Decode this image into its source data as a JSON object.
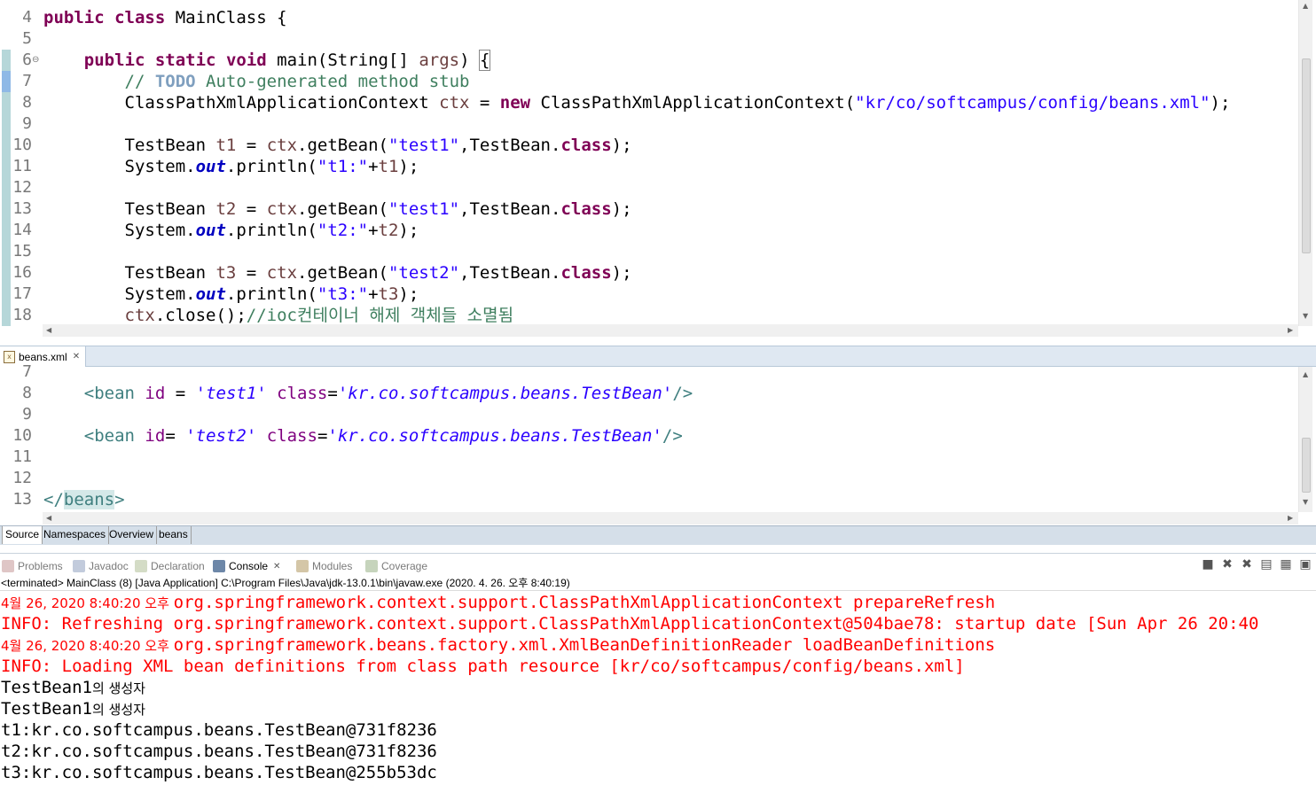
{
  "java_editor": {
    "lines": [
      {
        "num": "4",
        "tokens": [
          [
            "kw",
            "public"
          ],
          [
            "p",
            " "
          ],
          [
            "kw",
            "class"
          ],
          [
            "p",
            " MainClass {"
          ]
        ]
      },
      {
        "num": "5",
        "tokens": []
      },
      {
        "num": "6",
        "marker": "⊖",
        "tokens": [
          [
            "p",
            "    "
          ],
          [
            "kw",
            "public"
          ],
          [
            "p",
            " "
          ],
          [
            "kw",
            "static"
          ],
          [
            "p",
            " "
          ],
          [
            "kw",
            "void"
          ],
          [
            "p",
            " main(String[] "
          ],
          [
            "var",
            "args"
          ],
          [
            "p",
            ") {"
          ]
        ]
      },
      {
        "num": "7",
        "tokens": [
          [
            "p",
            "        "
          ],
          [
            "cmt",
            "// "
          ],
          [
            "todo",
            "TODO"
          ],
          [
            "cmt",
            " Auto-generated method stub"
          ]
        ]
      },
      {
        "num": "8",
        "tokens": [
          [
            "p",
            "        ClassPathXmlApplicationContext "
          ],
          [
            "var",
            "ctx"
          ],
          [
            "p",
            " = "
          ],
          [
            "kw",
            "new"
          ],
          [
            "p",
            " ClassPathXmlApplicationContext("
          ],
          [
            "str",
            "\"kr/co/softcampus/config/beans.xml\""
          ],
          [
            "p",
            ");"
          ]
        ]
      },
      {
        "num": "9",
        "tokens": []
      },
      {
        "num": "10",
        "tokens": [
          [
            "p",
            "        TestBean "
          ],
          [
            "var",
            "t1"
          ],
          [
            "p",
            " = "
          ],
          [
            "var",
            "ctx"
          ],
          [
            "p",
            ".getBean("
          ],
          [
            "str",
            "\"test1\""
          ],
          [
            "p",
            ",TestBean."
          ],
          [
            "kw",
            "class"
          ],
          [
            "p",
            ");"
          ]
        ]
      },
      {
        "num": "11",
        "tokens": [
          [
            "p",
            "        System."
          ],
          [
            "fld",
            "out"
          ],
          [
            "p",
            ".println("
          ],
          [
            "str",
            "\"t1:\""
          ],
          [
            "p",
            "+"
          ],
          [
            "var",
            "t1"
          ],
          [
            "p",
            ");"
          ]
        ]
      },
      {
        "num": "12",
        "tokens": []
      },
      {
        "num": "13",
        "tokens": [
          [
            "p",
            "        TestBean "
          ],
          [
            "var",
            "t2"
          ],
          [
            "p",
            " = "
          ],
          [
            "var",
            "ctx"
          ],
          [
            "p",
            ".getBean("
          ],
          [
            "str",
            "\"test1\""
          ],
          [
            "p",
            ",TestBean."
          ],
          [
            "kw",
            "class"
          ],
          [
            "p",
            ");"
          ]
        ]
      },
      {
        "num": "14",
        "tokens": [
          [
            "p",
            "        System."
          ],
          [
            "fld",
            "out"
          ],
          [
            "p",
            ".println("
          ],
          [
            "str",
            "\"t2:\""
          ],
          [
            "p",
            "+"
          ],
          [
            "var",
            "t2"
          ],
          [
            "p",
            ");"
          ]
        ]
      },
      {
        "num": "15",
        "tokens": []
      },
      {
        "num": "16",
        "tokens": [
          [
            "p",
            "        TestBean "
          ],
          [
            "var",
            "t3"
          ],
          [
            "p",
            " = "
          ],
          [
            "var",
            "ctx"
          ],
          [
            "p",
            ".getBean("
          ],
          [
            "str",
            "\"test2\""
          ],
          [
            "p",
            ",TestBean."
          ],
          [
            "kw",
            "class"
          ],
          [
            "p",
            ");"
          ]
        ]
      },
      {
        "num": "17",
        "tokens": [
          [
            "p",
            "        System."
          ],
          [
            "fld",
            "out"
          ],
          [
            "p",
            ".println("
          ],
          [
            "str",
            "\"t3:\""
          ],
          [
            "p",
            "+"
          ],
          [
            "var",
            "t3"
          ],
          [
            "p",
            ");"
          ]
        ]
      },
      {
        "num": "18",
        "tokens": [
          [
            "p",
            "        "
          ],
          [
            "var",
            "ctx"
          ],
          [
            "p",
            ".close();"
          ],
          [
            "cmt",
            "//ioc컨테이너 해제 객체들 소멸됨"
          ]
        ]
      }
    ]
  },
  "xml_editor": {
    "tab_label": "beans.xml",
    "tab_close": "✕",
    "lines": [
      {
        "num": "7",
        "tokens": []
      },
      {
        "num": "8",
        "tokens": [
          [
            "p",
            "    "
          ],
          [
            "xtag",
            "<bean"
          ],
          [
            "p",
            " "
          ],
          [
            "xattr",
            "id"
          ],
          [
            "p",
            " = "
          ],
          [
            "xval",
            "'test1'"
          ],
          [
            "p",
            " "
          ],
          [
            "xattr",
            "class"
          ],
          [
            "p",
            "="
          ],
          [
            "xval",
            "'kr.co.softcampus.beans.TestBean'"
          ],
          [
            "xtag",
            "/>"
          ]
        ]
      },
      {
        "num": "9",
        "tokens": []
      },
      {
        "num": "10",
        "tokens": [
          [
            "p",
            "    "
          ],
          [
            "xtag",
            "<bean"
          ],
          [
            "p",
            " "
          ],
          [
            "xattr",
            "id"
          ],
          [
            "p",
            "= "
          ],
          [
            "xval",
            "'test2'"
          ],
          [
            "p",
            " "
          ],
          [
            "xattr",
            "class"
          ],
          [
            "p",
            "="
          ],
          [
            "xval",
            "'kr.co.softcampus.beans.TestBean'"
          ],
          [
            "xtag",
            "/>"
          ]
        ]
      },
      {
        "num": "11",
        "tokens": []
      },
      {
        "num": "12",
        "tokens": []
      },
      {
        "num": "13",
        "tokens": [
          [
            "xtag",
            "</"
          ],
          [
            "xtag",
            "beans"
          ],
          [
            "xtag",
            ">"
          ]
        ]
      }
    ],
    "bottom_tabs": [
      "Source",
      "Namespaces",
      "Overview",
      "beans"
    ]
  },
  "console": {
    "tabs": [
      {
        "label": "Problems",
        "icon": "problems-icon",
        "active": false
      },
      {
        "label": "Javadoc",
        "icon": "javadoc-icon",
        "active": false
      },
      {
        "label": "Declaration",
        "icon": "declaration-icon",
        "active": false
      },
      {
        "label": "Console",
        "icon": "console-icon",
        "active": true,
        "close": "✕"
      },
      {
        "label": "Modules",
        "icon": "modules-icon",
        "active": false
      },
      {
        "label": "Coverage",
        "icon": "coverage-icon",
        "active": false
      }
    ],
    "header": "<terminated> MainClass (8) [Java Application] C:\\Program Files\\Java\\jdk-13.0.1\\bin\\javaw.exe (2020. 4. 26. 오후 8:40:19)",
    "output": [
      {
        "color": "red",
        "date": "4월 26, 2020 8:40:20 오후 ",
        "text": "org.springframework.context.support.ClassPathXmlApplicationContext prepareRefresh"
      },
      {
        "color": "red",
        "text": "INFO: Refreshing org.springframework.context.support.ClassPathXmlApplicationContext@504bae78: startup date [Sun Apr 26 20:40"
      },
      {
        "color": "red",
        "date": "4월 26, 2020 8:40:20 오후 ",
        "text": "org.springframework.beans.factory.xml.XmlBeanDefinitionReader loadBeanDefinitions"
      },
      {
        "color": "red",
        "text": "INFO: Loading XML bean definitions from class path resource [kr/co/softcampus/config/beans.xml]"
      },
      {
        "color": "black",
        "text": "TestBean1",
        "suffix": "의 생성자"
      },
      {
        "color": "black",
        "text": "TestBean1",
        "suffix": "의 생성자"
      },
      {
        "color": "black",
        "text": "t1:kr.co.softcampus.beans.TestBean@731f8236"
      },
      {
        "color": "black",
        "text": "t2:kr.co.softcampus.beans.TestBean@731f8236"
      },
      {
        "color": "black",
        "text": "t3:kr.co.softcampus.beans.TestBean@255b53dc"
      }
    ],
    "toolbar": [
      "terminate-icon",
      "remove-launch-icon",
      "remove-all-icon",
      "scroll-lock-icon",
      "pin-icon",
      "display-console-icon"
    ]
  }
}
